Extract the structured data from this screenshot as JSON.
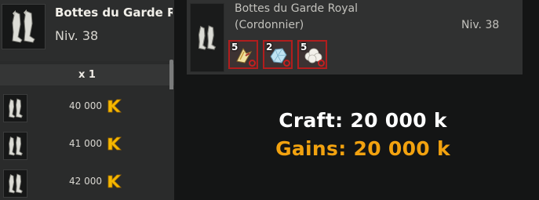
{
  "item": {
    "name": "Bottes du Garde Royal",
    "level": "Niv. 38",
    "icon": "boots-icon"
  },
  "quantity_label": "x 1",
  "prices": [
    {
      "value": "40 000",
      "currency_icon": "kama-icon"
    },
    {
      "value": "41 000",
      "currency_icon": "kama-icon"
    },
    {
      "value": "42 000",
      "currency_icon": "kama-icon"
    }
  ],
  "recipe": {
    "name": "Bottes du Garde Royal",
    "job": "(Cordonnier)",
    "level": "Niv. 38",
    "ingredients": [
      {
        "qty": "5",
        "icon": "wing-feather-icon"
      },
      {
        "qty": "2",
        "icon": "crystal-icon"
      },
      {
        "qty": "5",
        "icon": "wool-icon"
      }
    ]
  },
  "summary": {
    "craft": "Craft: 20 000 k",
    "gains": "Gains: 20 000 k"
  },
  "colors": {
    "gains": "#f2a20f",
    "ingredient_border": "#b21d1d",
    "kama": "#f5b800"
  }
}
